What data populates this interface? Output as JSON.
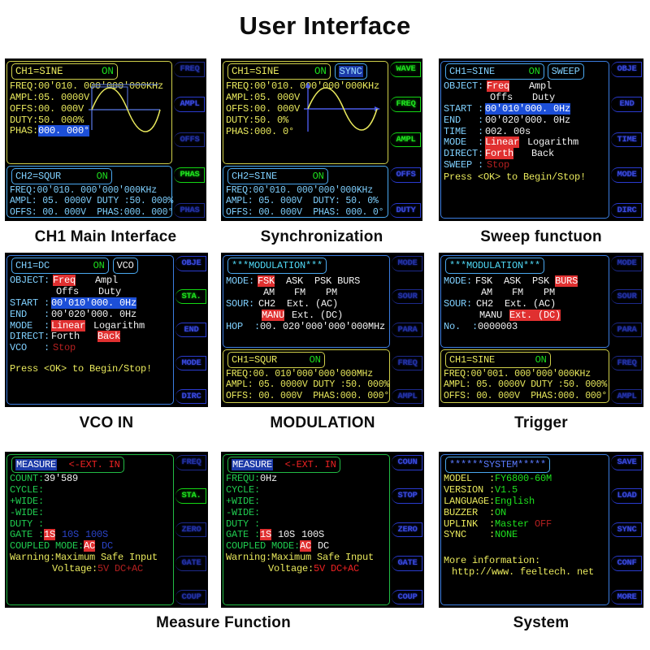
{
  "page": {
    "title": "User Interface"
  },
  "colors": {
    "background": "#ffffff",
    "lcd_background": "#000000",
    "yellow": "#e8e85c",
    "green": "#1ee01e",
    "cyan": "#4fd8f5",
    "blue": "#5aa8f8",
    "white": "#f2f2f2",
    "red": "#ee2222",
    "select_blue": "#1c4fd8",
    "select_red": "#e03030",
    "softkey_blue": "#3a4ad8",
    "softkey_green": "#22e022"
  },
  "panels": [
    {
      "id": "ch1-main",
      "caption": "CH1 Main Interface",
      "header": {
        "channel": "CH1=SINE",
        "state": "ON",
        "mode_tag": ""
      },
      "ch1": {
        "freq_label": "FREQ:",
        "freq_value": "00'010. 000'000'000KHz",
        "ampl_label": "AMPL:",
        "ampl_value": "05. 0000V",
        "offs_label": "OFFS:",
        "offs_value": "00. 000V",
        "duty_label": "DUTY:",
        "duty_value": "50. 000%",
        "phas_label": "PHAS:",
        "phas_value": "000. 000°"
      },
      "ch2": {
        "header": "CH2=SQUR",
        "state": "ON",
        "line1": "FREQ:00'010. 000'000'000KHz",
        "line2": "AMPL: 05. 0000V DUTY :50. 000%",
        "line3": "OFFS: 00. 000V  PHAS:000. 000°"
      },
      "softkeys": [
        {
          "label": "FREQ",
          "active": false
        },
        {
          "label": "AMPL",
          "active": false
        },
        {
          "label": "OFFS",
          "active": false
        },
        {
          "label": "PHAS",
          "active": true
        },
        {
          "label": "PHAS",
          "active": false
        }
      ]
    },
    {
      "id": "synchronization",
      "caption": "Synchronization",
      "header": {
        "channel": "CH1=SINE",
        "state": "ON",
        "mode_tag": "SYNC"
      },
      "ch1": {
        "freq_label": "FREQ:",
        "freq_value": "00'010. 000'000'000KHz",
        "ampl_label": "AMPL:",
        "ampl_value": "05. 000V",
        "offs_label": "OFFS:",
        "offs_value": "00. 000V",
        "duty_label": "DUTY:",
        "duty_value": "50. 0%",
        "phas_label": "PHAS:",
        "phas_value": "000. 0°"
      },
      "ch2": {
        "header": "CH2=SINE",
        "state": "ON",
        "line1": "FREQ:00'010. 000'000'000KHz",
        "line2": "AMPL: 05. 000V  DUTY: 50. 0%",
        "line3": "OFFS: 00. 000V  PHAS: 000. 0°"
      },
      "softkeys": [
        {
          "label": "WAVE",
          "active": true
        },
        {
          "label": "FREQ",
          "active": true
        },
        {
          "label": "AMPL",
          "active": true
        },
        {
          "label": "OFFS",
          "active": false
        },
        {
          "label": "DUTY",
          "active": false
        }
      ]
    },
    {
      "id": "sweep",
      "caption": "Sweep functuon",
      "header": {
        "channel": "CH1=SINE",
        "state": "ON",
        "mode_tag": "SWEEP"
      },
      "rows": [
        {
          "label": "OBJECT:",
          "opt1": "Freq",
          "opt1_sel": true,
          "opt2": "Ampl",
          "opt2_sel": false
        },
        {
          "label": "",
          "opt1": "Offs",
          "opt1_sel": false,
          "opt2": "Duty",
          "opt2_sel": false
        },
        {
          "label": "START :",
          "value": "00'010'000. 0Hz",
          "value_sel": true
        },
        {
          "label": "END   :",
          "value": "00'020'000. 0Hz",
          "value_sel": false
        },
        {
          "label": "TIME  :",
          "value": "002. 00s",
          "value_sel": false
        },
        {
          "label": "MODE  :",
          "opt1": "Linear",
          "opt1_sel": true,
          "opt2": "Logarithm",
          "opt2_sel": false
        },
        {
          "label": "DIRECT:",
          "opt1": "Forth",
          "opt1_sel": true,
          "opt2": "Back",
          "opt2_sel": false
        },
        {
          "label": "SWEEP :",
          "value": "Stop",
          "value_color": "red"
        }
      ],
      "footer": "Press <OK> to Begin/Stop!",
      "softkeys": [
        {
          "label": "OBJE",
          "active": false
        },
        {
          "label": "END",
          "active": false
        },
        {
          "label": "TIME",
          "active": false
        },
        {
          "label": "MODE",
          "active": false
        },
        {
          "label": "DIRC",
          "active": false
        }
      ]
    },
    {
      "id": "vco-in",
      "caption": "VCO IN",
      "header": {
        "channel": "CH1=DC",
        "state": "ON",
        "mode_tag": "VCO"
      },
      "rows": [
        {
          "label": "OBJECT:",
          "opt1": "Freq",
          "opt1_sel": true,
          "opt2": "Ampl",
          "opt2_sel": false
        },
        {
          "label": "",
          "opt1": "Offs",
          "opt1_sel": false,
          "opt2": "Duty",
          "opt2_sel": false
        },
        {
          "label": "START :",
          "value": "00'010'000. 0Hz",
          "value_sel": true
        },
        {
          "label": "END   :",
          "value": "00'020'000. 0Hz",
          "value_sel": false
        },
        {
          "label": "MODE  :",
          "opt1": "Linear",
          "opt1_sel": true,
          "opt2": "Logarithm",
          "opt2_sel": false
        },
        {
          "label": "DIRECT:",
          "opt1": "Forth",
          "opt1_sel": false,
          "opt2": "Back",
          "opt2_sel": true
        },
        {
          "label": "VCO   :",
          "value": "Stop",
          "value_color": "red"
        }
      ],
      "footer": "Press <OK> to Begin/Stop!",
      "softkeys": [
        {
          "label": "OBJE",
          "active": false
        },
        {
          "label": "STA.",
          "active": true
        },
        {
          "label": "END",
          "active": false
        },
        {
          "label": "MODE",
          "active": false
        },
        {
          "label": "DIRC",
          "active": false
        }
      ]
    },
    {
      "id": "modulation",
      "caption": "MODULATION",
      "title": "***MODULATION***",
      "mode_label": "MODE:",
      "modes_row1": [
        {
          "label": "FSK",
          "sel": true
        },
        {
          "label": "ASK",
          "sel": false
        },
        {
          "label": "PSK",
          "sel": false
        },
        {
          "label": "BURS",
          "sel": false
        }
      ],
      "modes_row2": [
        {
          "label": "AM",
          "sel": false
        },
        {
          "label": "FM",
          "sel": false
        },
        {
          "label": "PM",
          "sel": false
        }
      ],
      "sour_label": "SOUR:",
      "sources_row1": [
        {
          "label": "CH2",
          "sel": false
        },
        {
          "label": "Ext. (AC)",
          "sel": false
        }
      ],
      "sources_row2": [
        {
          "label": "MANU",
          "sel": true
        },
        {
          "label": "Ext. (DC)",
          "sel": false
        }
      ],
      "param_label": "HOP  :",
      "param_value": "00. 020'000'000'000MHz",
      "ch": {
        "header": "CH1=SQUR",
        "state": "ON",
        "line1": "FREQ:00. 010'000'000'000MHz",
        "line2": "AMPL: 05. 0000V DUTY :50. 000%",
        "line3": "OFFS: 00. 000V  PHAS:000. 000°"
      },
      "softkeys": [
        {
          "label": "MODE",
          "active": false
        },
        {
          "label": "SOUR",
          "active": false
        },
        {
          "label": "PARA",
          "active": false
        },
        {
          "label": "FREQ",
          "active": false
        },
        {
          "label": "AMPL",
          "active": false
        }
      ]
    },
    {
      "id": "trigger",
      "caption": "Trigger",
      "title": "***MODULATION***",
      "mode_label": "MODE:",
      "modes_row1": [
        {
          "label": "FSK",
          "sel": false
        },
        {
          "label": "ASK",
          "sel": false
        },
        {
          "label": "PSK",
          "sel": false
        },
        {
          "label": "BURS",
          "sel": true
        }
      ],
      "modes_row2": [
        {
          "label": "AM",
          "sel": false
        },
        {
          "label": "FM",
          "sel": false
        },
        {
          "label": "PM",
          "sel": false
        }
      ],
      "sour_label": "SOUR:",
      "sources_row1": [
        {
          "label": "CH2",
          "sel": false
        },
        {
          "label": "Ext. (AC)",
          "sel": false
        }
      ],
      "sources_row2": [
        {
          "label": "MANU",
          "sel": false
        },
        {
          "label": "Ext. (DC)",
          "sel": true
        }
      ],
      "param_label": "No.  :",
      "param_value": "0000003",
      "ch": {
        "header": "CH1=SINE",
        "state": "ON",
        "line1": "FREQ:00'001. 000'000'000KHz",
        "line2": "AMPL: 05. 0000V DUTY :50. 000%",
        "line3": "OFFS: 00. 000V  PHAS:000. 000°"
      },
      "softkeys": [
        {
          "label": "MODE",
          "active": false
        },
        {
          "label": "SOUR",
          "active": false
        },
        {
          "label": "PARA",
          "active": false
        },
        {
          "label": "FREQ",
          "active": false
        },
        {
          "label": "AMPL",
          "active": false
        }
      ]
    },
    {
      "id": "measure-count",
      "caption": "Measure Function",
      "title_main": "MEASURE",
      "title_sub": "<-EXT. IN",
      "rows": [
        {
          "label": "COUNT:",
          "value": "39'589"
        },
        {
          "label": "CYCLE:",
          "value": ""
        },
        {
          "label": "+WIDE:",
          "value": ""
        },
        {
          "label": "-WIDE:",
          "value": ""
        },
        {
          "label": "DUTY :",
          "value": ""
        }
      ],
      "gate_label": "GATE :",
      "gate_options": [
        {
          "label": "1S",
          "sel": true,
          "dim": false
        },
        {
          "label": "10S",
          "sel": false,
          "dim": true
        },
        {
          "label": "100S",
          "sel": false,
          "dim": true
        }
      ],
      "coupled_label": "COUPLED MODE:",
      "coupled_options": [
        {
          "label": "AC",
          "sel": true,
          "dim": false
        },
        {
          "label": "DC",
          "sel": false,
          "dim": true
        }
      ],
      "warning_line1": "Warning:Maximum Safe Input",
      "warning_line2_prefix": "Voltage:",
      "warning_line2_value": "5V DC+AC",
      "softkeys": [
        {
          "label": "FREQ",
          "active": false
        },
        {
          "label": "STA.",
          "active": true
        },
        {
          "label": "ZERO",
          "active": false
        },
        {
          "label": "GATE",
          "active": false
        },
        {
          "label": "COUP",
          "active": false
        }
      ]
    },
    {
      "id": "measure-frequ",
      "caption": "",
      "title_main": "MEASURE",
      "title_sub": "<-EXT. IN",
      "rows": [
        {
          "label": "FREQU:",
          "value": "0Hz"
        },
        {
          "label": "CYCLE:",
          "value": ""
        },
        {
          "label": "+WIDE:",
          "value": ""
        },
        {
          "label": "-WIDE:",
          "value": ""
        },
        {
          "label": "DUTY :",
          "value": ""
        }
      ],
      "gate_label": "GATE :",
      "gate_options": [
        {
          "label": "1S",
          "sel": true,
          "dim": false
        },
        {
          "label": "10S",
          "sel": false,
          "dim": false
        },
        {
          "label": "100S",
          "sel": false,
          "dim": false
        }
      ],
      "coupled_label": "COUPLED MODE:",
      "coupled_options": [
        {
          "label": "AC",
          "sel": true,
          "dim": false
        },
        {
          "label": "DC",
          "sel": false,
          "dim": false
        }
      ],
      "warning_line1": "Warning:Maximum Safe Input",
      "warning_line2_prefix": "Voltage:",
      "warning_line2_value": "5V DC+AC",
      "softkeys": [
        {
          "label": "COUN",
          "active": false
        },
        {
          "label": "STOP",
          "active": false
        },
        {
          "label": "ZERO",
          "active": false
        },
        {
          "label": "GATE",
          "active": false
        },
        {
          "label": "COUP",
          "active": false
        }
      ]
    },
    {
      "id": "system",
      "caption": "System",
      "title": "******SYSTEM*****",
      "rows": [
        {
          "label": "MODEL   :",
          "value": "FY6800-60M",
          "extra": "",
          "extra_color": ""
        },
        {
          "label": "VERSION :",
          "value": "V1.5",
          "extra": "",
          "extra_color": ""
        },
        {
          "label": "LANGUAGE:",
          "value": "English",
          "extra": "",
          "extra_color": ""
        },
        {
          "label": "BUZZER  :",
          "value": "ON",
          "extra": "",
          "extra_color": ""
        },
        {
          "label": "UPLINK  :",
          "value": "Master",
          "extra": "OFF",
          "extra_color": "red"
        },
        {
          "label": "SYNC    :",
          "value": "NONE",
          "extra": "",
          "extra_color": ""
        }
      ],
      "more_label": "More information:",
      "more_url": "http://www. feeltech. net",
      "softkeys": [
        {
          "label": "SAVE",
          "active": false
        },
        {
          "label": "LOAD",
          "active": false
        },
        {
          "label": "SYNC",
          "active": false
        },
        {
          "label": "CONF",
          "active": false
        },
        {
          "label": "MORE",
          "active": false
        }
      ]
    }
  ],
  "captions_row1": [
    "CH1 Main Interface",
    "Synchronization",
    "Sweep functuon"
  ],
  "captions_row2": [
    "VCO IN",
    "MODULATION",
    "Trigger"
  ],
  "captions_row3": [
    "Measure Function",
    "System"
  ]
}
